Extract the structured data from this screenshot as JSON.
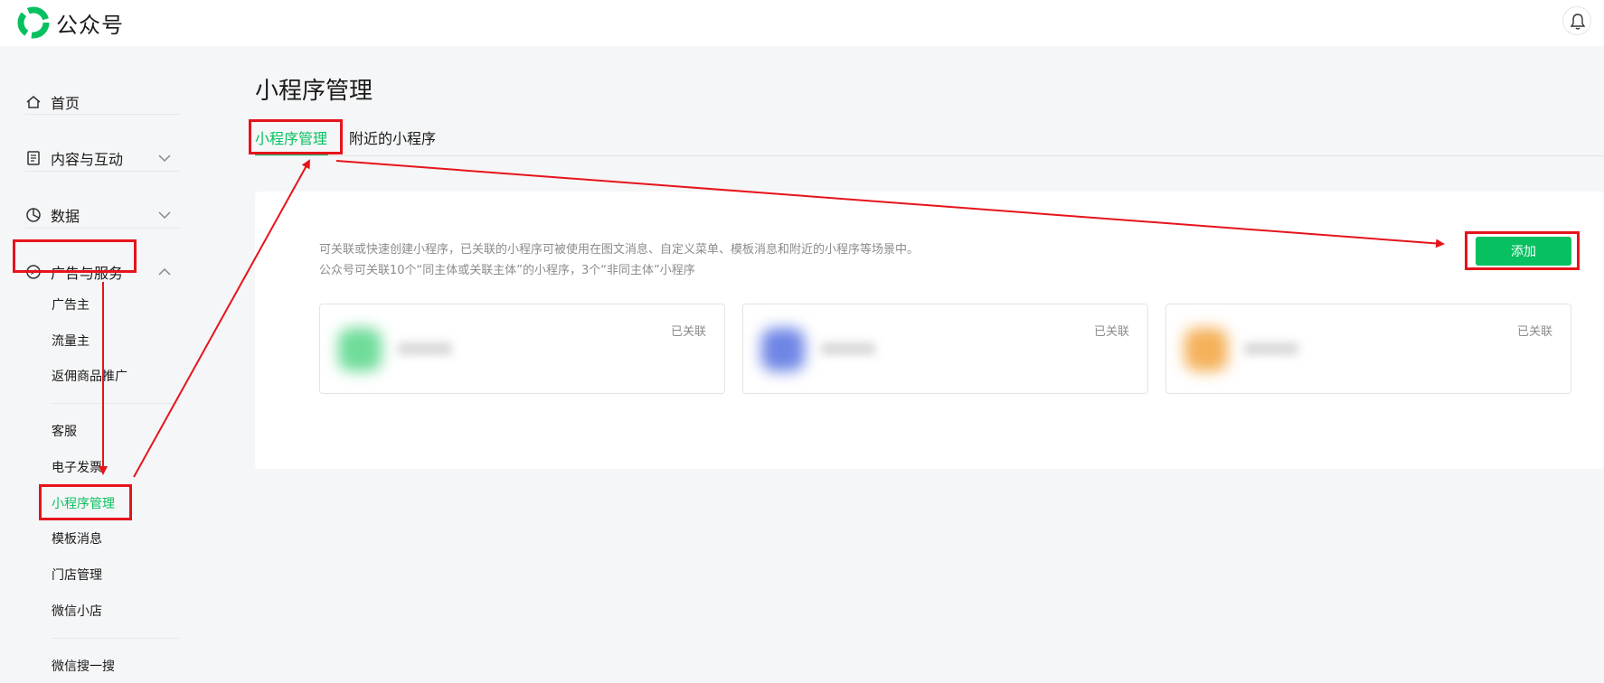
{
  "header": {
    "brand": "公众号"
  },
  "sidebar": {
    "nav": [
      {
        "label": "首页",
        "icon": "home-icon"
      },
      {
        "label": "内容与互动",
        "icon": "document-icon"
      },
      {
        "label": "数据",
        "icon": "pie-chart-icon"
      },
      {
        "label": "广告与服务",
        "icon": "compass-icon",
        "expanded": true
      }
    ],
    "sub_items": [
      "广告主",
      "流量主",
      "返佣商品推广",
      "客服",
      "电子发票",
      "小程序管理",
      "模板消息",
      "门店管理",
      "微信小店",
      "微信搜一搜"
    ],
    "active_sub": "小程序管理"
  },
  "main": {
    "title": "小程序管理",
    "tabs": [
      {
        "label": "小程序管理",
        "active": true
      },
      {
        "label": "附近的小程序",
        "active": false
      }
    ],
    "desc_line1": "可关联或快速创建小程序，已关联的小程序可被使用在图文消息、自定义菜单、模板消息和附近的小程序等场景中。",
    "desc_line2": "公众号可关联10个“同主体或关联主体”的小程序，3个“非同主体”小程序",
    "add_button": "添加",
    "miniprograms": [
      {
        "status": "已关联",
        "avatar_color": "#6fdc9a"
      },
      {
        "status": "已关联",
        "avatar_color": "#6f86e6"
      },
      {
        "status": "已关联",
        "avatar_color": "#f5b15a"
      }
    ]
  },
  "colors": {
    "accent": "#07c160",
    "annotation": "#e6141b",
    "background": "#f5f6f7"
  }
}
